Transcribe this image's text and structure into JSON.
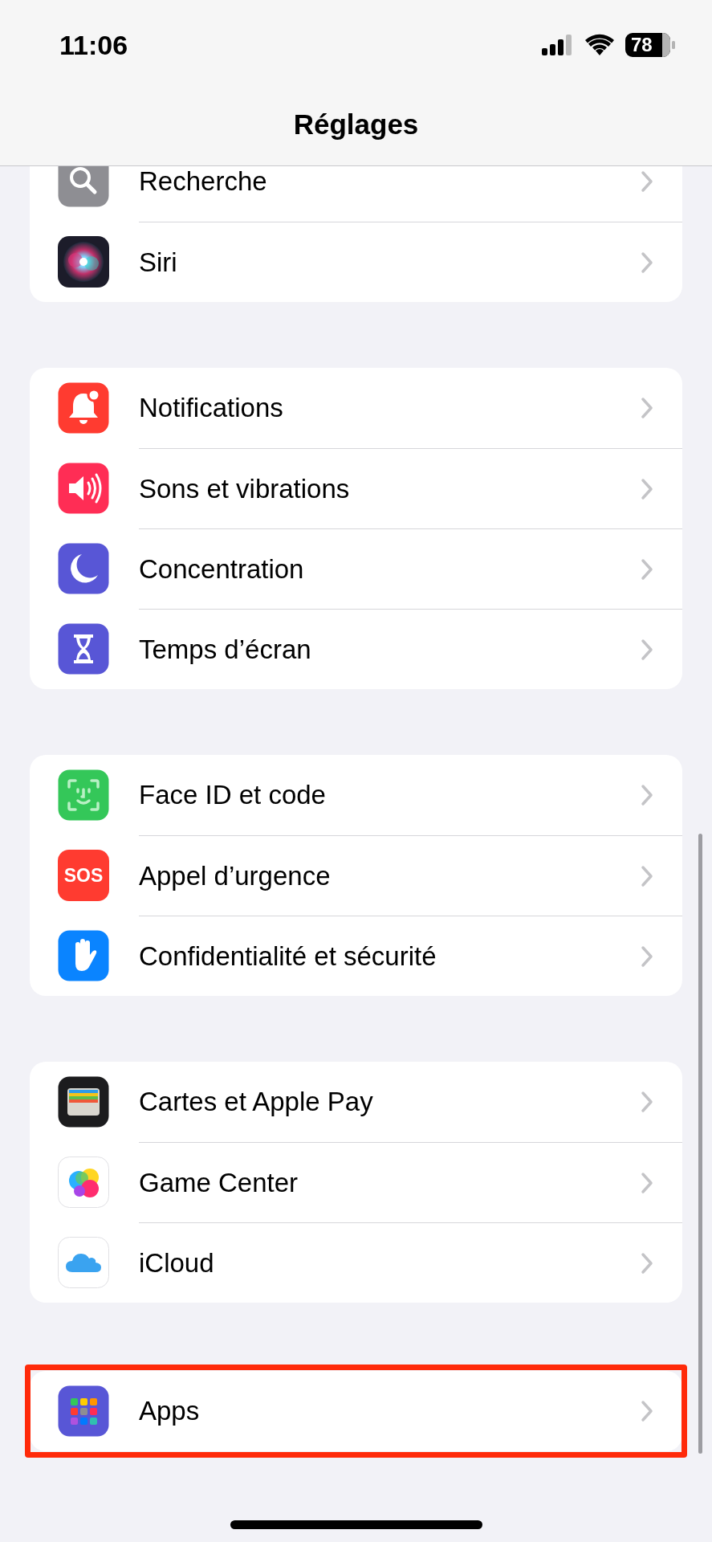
{
  "status_bar": {
    "time": "11:06",
    "battery": "78"
  },
  "window": {
    "title": "Réglages"
  },
  "groups": [
    {
      "items": [
        {
          "kind": "search",
          "label": "Recherche",
          "highlighted": false
        },
        {
          "kind": "siri",
          "label": "Siri",
          "highlighted": false
        }
      ]
    },
    {
      "items": [
        {
          "kind": "bell",
          "label": "Notifications",
          "highlighted": false
        },
        {
          "kind": "speaker",
          "label": "Sons et vibrations",
          "highlighted": false
        },
        {
          "kind": "moon",
          "label": "Concentration",
          "highlighted": false
        },
        {
          "kind": "hourglass",
          "label": "Temps d’écran",
          "highlighted": false
        }
      ]
    },
    {
      "items": [
        {
          "kind": "faceid",
          "label": "Face ID et code",
          "highlighted": false
        },
        {
          "kind": "sos",
          "label": "Appel d’urgence",
          "icon_text": "SOS",
          "highlighted": false
        },
        {
          "kind": "hand",
          "label": "Confidentialité et sécurité",
          "highlighted": false
        }
      ]
    },
    {
      "items": [
        {
          "kind": "wallet",
          "label": "Cartes et Apple Pay",
          "highlighted": false
        },
        {
          "kind": "gamecenter",
          "label": "Game Center",
          "highlighted": false
        },
        {
          "kind": "cloud",
          "label": "iCloud",
          "highlighted": false
        }
      ]
    },
    {
      "items": [
        {
          "kind": "apps",
          "label": "Apps",
          "highlighted": true
        }
      ]
    }
  ]
}
